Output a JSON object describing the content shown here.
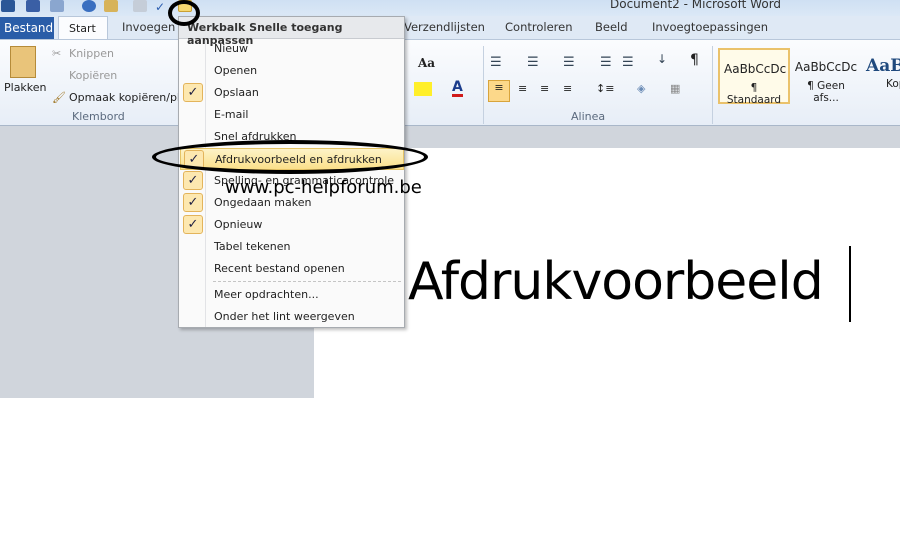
{
  "window": {
    "title": "Document2 - Microsoft Word"
  },
  "quick_access": {
    "icons": [
      "word-icon",
      "save-icon",
      "undo-icon",
      "redo-icon",
      "spelling-icon",
      "print-preview-icon",
      "check-icon",
      "customize-dropdown-icon"
    ]
  },
  "tabs": [
    "Bestand",
    "Start",
    "Invoegen",
    "Verzendlijsten",
    "Controleren",
    "Beeld",
    "Invoegtoepassingen"
  ],
  "ribbon": {
    "clipboard": {
      "paste": "Plakken",
      "cut": "Knippen",
      "copy": "Kopiëren",
      "format_painter": "Opmaak kopiëren/plakken",
      "group": "Klembord"
    },
    "font": {
      "change_case": "Aa"
    },
    "paragraph": {
      "group": "Alinea"
    },
    "styles": [
      "AaBbCcDc",
      "AaBbCcDc",
      "AaB"
    ],
    "style_names": [
      "¶ Standaard",
      "¶ Geen afs...",
      "Kop"
    ]
  },
  "menu": {
    "header": "Werkbalk Snelle toegang aanpassen",
    "items": [
      {
        "label": "Nieuw",
        "checked": false
      },
      {
        "label": "Openen",
        "checked": false
      },
      {
        "label": "Opslaan",
        "checked": true
      },
      {
        "label": "E-mail",
        "checked": false
      },
      {
        "label": "Snel afdrukken",
        "checked": false
      },
      {
        "label": "Afdrukvoorbeeld en afdrukken",
        "checked": true,
        "highlighted": true
      },
      {
        "label": "Spelling- en grammaticacontrole",
        "checked": true
      },
      {
        "label": "Ongedaan maken",
        "checked": true
      },
      {
        "label": "Opnieuw",
        "checked": true
      },
      {
        "label": "Tabel tekenen",
        "checked": false
      },
      {
        "label": "Recent bestand openen",
        "checked": false
      },
      {
        "label": "Meer opdrachten...",
        "checked": false
      },
      {
        "label": "Onder het lint weergeven",
        "checked": false
      }
    ],
    "check_glyph": "✓"
  },
  "document": {
    "text": "Afdrukvoorbeeld"
  },
  "watermark": "www.pc-helpforum.be"
}
